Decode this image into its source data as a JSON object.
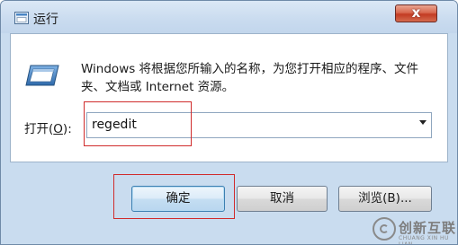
{
  "window": {
    "title": "运行",
    "close_glyph": "x",
    "title_icon": "run-dialog-icon"
  },
  "content": {
    "icon": "run-program-icon",
    "description": "Windows 将根据您所输入的名称，为您打开相应的程序、文件夹、文档或 Internet 资源。"
  },
  "open_field": {
    "label_prefix": "打开(",
    "label_key": "O",
    "label_suffix": "):",
    "value": "regedit",
    "dropdown_icon": "chevron-down-icon"
  },
  "buttons": {
    "ok": "确定",
    "cancel": "取消",
    "browse": "浏览(B)..."
  },
  "watermark": {
    "text": "创新互联",
    "sub": "CHUANG XIN HU LIAN"
  },
  "colors": {
    "highlight_box": "#d02c2c",
    "close_button": "#c33b22",
    "titlebar": "#c9dcef"
  }
}
